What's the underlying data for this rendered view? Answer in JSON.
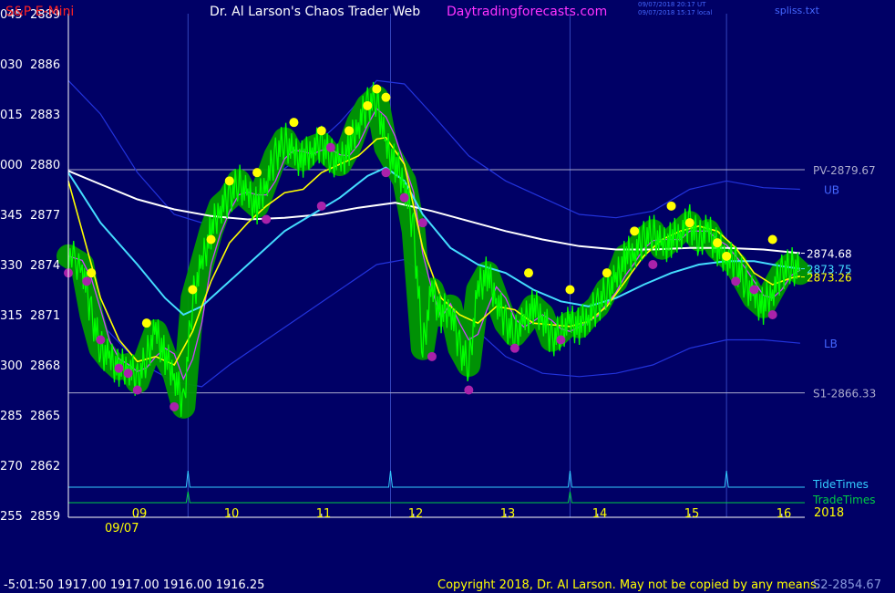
{
  "header": {
    "instrument": "S&P E-Mini",
    "title": "Dr. Al Larson's Chaos Trader Web",
    "site": "Daytradingforecasts.com",
    "stamp_utc": "09/07/2018 20:17 UT",
    "stamp_local": "09/07/2018 15:17 local",
    "file": "spliss.txt"
  },
  "footer": {
    "readout": "-5:01:50  1917.00 1917.00 1916.00 1916.25",
    "copyright": "Copyright 2018, Dr. Al Larson. May not be copied by any means.",
    "s2": "S2-2854.67"
  },
  "colors": {
    "background": "#000066",
    "price": "#00ff00",
    "halo": "#009900",
    "fast_avg": "#ffff00",
    "mid_avg": "#cc44ff",
    "slow_avg": "#44ddff",
    "long_avg": "#ffffff",
    "bands": "#2233dd",
    "levels": "#aaaacc",
    "tide": "#33ccff",
    "trade": "#00cc44",
    "high_dot": "#ffff00",
    "low_dot": "#aa22aa",
    "hour_line": "#3344bb"
  },
  "chart_data": {
    "type": "line",
    "title": "S&P E-Mini",
    "ylim": [
      2859,
      2889
    ],
    "y_ticks_left": [
      {
        "code": "045",
        "price": "2889",
        "value": 2889
      },
      {
        "code": "030",
        "price": "2886",
        "value": 2886
      },
      {
        "code": "015",
        "price": "2883",
        "value": 2883
      },
      {
        "code": "000",
        "price": "2880",
        "value": 2880
      },
      {
        "code": "345",
        "price": "2877",
        "value": 2877
      },
      {
        "code": "330",
        "price": "2874",
        "value": 2874
      },
      {
        "code": "315",
        "price": "2871",
        "value": 2871
      },
      {
        "code": "300",
        "price": "2868",
        "value": 2868
      },
      {
        "code": "285",
        "price": "2865",
        "value": 2865
      },
      {
        "code": "270",
        "price": "2862",
        "value": 2862
      },
      {
        "code": "255",
        "price": "2859",
        "value": 2859
      }
    ],
    "x_ticks": [
      {
        "label": "09",
        "hour": 9
      },
      {
        "label": "10",
        "hour": 10
      },
      {
        "label": "11",
        "hour": 11
      },
      {
        "label": "12",
        "hour": 12
      },
      {
        "label": "13",
        "hour": 13
      },
      {
        "label": "14",
        "hour": 14
      },
      {
        "label": "15",
        "hour": 15
      },
      {
        "label": "16",
        "hour": 16
      }
    ],
    "xlim_hours": [
      8.25,
      16.25
    ],
    "date_label": "09/07",
    "year_label": "2018",
    "levels": [
      {
        "label": "PV-2879.67",
        "value": 2879.67
      },
      {
        "label": "S1-2866.33",
        "value": 2866.33
      }
    ],
    "band_labels": [
      {
        "label": "UB",
        "value": 2878.5
      },
      {
        "label": "LB",
        "value": 2869.3
      }
    ],
    "right_values": [
      {
        "label": "2874.68",
        "value": 2874.68,
        "color": "#ffffff"
      },
      {
        "label": "2873.75",
        "value": 2873.75,
        "color": "#44ddff"
      },
      {
        "label": "2873.26",
        "value": 2873.26,
        "color": "#ffff00"
      }
    ],
    "marker_rows": [
      {
        "label": "TideTimes",
        "hours": [
          9.55,
          11.75,
          13.7,
          15.4
        ]
      },
      {
        "label": "TradeTimes",
        "hours": [
          9.55,
          13.7
        ]
      }
    ],
    "series": [
      {
        "name": "price",
        "hours": [
          8.25,
          8.4,
          8.5,
          8.6,
          8.7,
          8.8,
          8.9,
          9.0,
          9.1,
          9.2,
          9.3,
          9.4,
          9.5,
          9.6,
          9.7,
          9.8,
          9.9,
          10.0,
          10.1,
          10.2,
          10.3,
          10.4,
          10.5,
          10.6,
          10.7,
          10.8,
          10.9,
          11.0,
          11.1,
          11.2,
          11.3,
          11.4,
          11.5,
          11.6,
          11.7,
          11.8,
          11.9,
          12.0,
          12.1,
          12.2,
          12.3,
          12.4,
          12.5,
          12.6,
          12.7,
          12.8,
          12.9,
          13.0,
          13.1,
          13.2,
          13.3,
          13.4,
          13.5,
          13.6,
          13.7,
          13.8,
          13.9,
          14.0,
          14.1,
          14.2,
          14.3,
          14.4,
          14.5,
          14.6,
          14.7,
          14.8,
          14.9,
          15.0,
          15.1,
          15.2,
          15.3,
          15.4,
          15.5,
          15.6,
          15.7,
          15.8,
          15.9,
          16.0,
          16.1,
          16.2
        ],
        "values": [
          2874.5,
          2874.0,
          2871.0,
          2869.0,
          2868.3,
          2867.8,
          2868.0,
          2867.0,
          2868.5,
          2870.0,
          2868.5,
          2867.5,
          2865.5,
          2872.0,
          2874.0,
          2876.0,
          2877.5,
          2878.0,
          2879.0,
          2878.0,
          2877.5,
          2879.0,
          2880.5,
          2881.5,
          2880.5,
          2880.3,
          2881.0,
          2881.2,
          2880.5,
          2880.0,
          2881.0,
          2882.5,
          2883.5,
          2884.0,
          2881.0,
          2880.0,
          2879.0,
          2876.0,
          2869.0,
          2872.5,
          2871.0,
          2871.5,
          2869.0,
          2868.0,
          2872.5,
          2873.5,
          2872.0,
          2870.5,
          2869.8,
          2870.5,
          2871.5,
          2871.0,
          2869.5,
          2870.0,
          2870.5,
          2870.3,
          2871.0,
          2871.5,
          2872.5,
          2873.0,
          2874.5,
          2874.8,
          2875.5,
          2876.0,
          2875.0,
          2875.5,
          2876.0,
          2876.5,
          2875.5,
          2876.0,
          2875.0,
          2874.5,
          2874.0,
          2873.0,
          2872.0,
          2871.5,
          2872.5,
          2873.5,
          2874.0,
          2873.5
        ]
      },
      {
        "name": "fast_avg",
        "hours": [
          8.25,
          8.4,
          8.6,
          8.8,
          9.0,
          9.2,
          9.4,
          9.6,
          9.8,
          10.0,
          10.2,
          10.4,
          10.6,
          10.8,
          11.0,
          11.2,
          11.4,
          11.6,
          11.7,
          11.9,
          12.1,
          12.3,
          12.5,
          12.7,
          12.9,
          13.1,
          13.3,
          13.5,
          13.7,
          13.9,
          14.1,
          14.3,
          14.5,
          14.7,
          14.9,
          15.1,
          15.3,
          15.5,
          15.7,
          15.9,
          16.1,
          16.2
        ],
        "values": [
          2879.0,
          2876.0,
          2872.0,
          2869.5,
          2868.2,
          2868.5,
          2868.0,
          2870.0,
          2873.0,
          2875.3,
          2876.5,
          2877.5,
          2878.3,
          2878.5,
          2879.5,
          2880.0,
          2880.5,
          2881.5,
          2881.6,
          2880.0,
          2875.0,
          2872.0,
          2871.0,
          2870.5,
          2871.5,
          2871.3,
          2870.5,
          2870.4,
          2870.3,
          2870.6,
          2871.5,
          2873.0,
          2874.5,
          2875.5,
          2876.0,
          2876.3,
          2876.0,
          2875.0,
          2873.5,
          2872.8,
          2873.2,
          2873.3
        ]
      },
      {
        "name": "slow_avg",
        "hours": [
          8.25,
          8.6,
          9.0,
          9.3,
          9.5,
          9.7,
          10.0,
          10.3,
          10.6,
          10.9,
          11.2,
          11.5,
          11.7,
          11.9,
          12.1,
          12.4,
          12.7,
          13.0,
          13.3,
          13.6,
          13.9,
          14.2,
          14.5,
          14.8,
          15.1,
          15.4,
          15.7,
          16.0,
          16.2
        ],
        "values": [
          2879.5,
          2876.5,
          2874.0,
          2872.0,
          2871.0,
          2871.5,
          2873.0,
          2874.5,
          2876.0,
          2877.0,
          2878.0,
          2879.3,
          2879.8,
          2879.0,
          2877.0,
          2875.0,
          2874.0,
          2873.5,
          2872.5,
          2871.8,
          2871.5,
          2872.0,
          2872.8,
          2873.5,
          2874.0,
          2874.2,
          2874.2,
          2873.9,
          2873.75
        ]
      },
      {
        "name": "long_avg",
        "hours": [
          8.25,
          8.6,
          9.0,
          9.4,
          9.8,
          10.2,
          10.6,
          11.0,
          11.4,
          11.8,
          12.2,
          12.6,
          13.0,
          13.4,
          13.8,
          14.2,
          14.6,
          15.0,
          15.4,
          15.8,
          16.2
        ],
        "values": [
          2879.6,
          2878.8,
          2877.9,
          2877.3,
          2876.9,
          2876.7,
          2876.8,
          2877.0,
          2877.4,
          2877.7,
          2877.2,
          2876.6,
          2876.0,
          2875.5,
          2875.1,
          2874.9,
          2874.9,
          2875.0,
          2875.0,
          2874.9,
          2874.68
        ]
      },
      {
        "name": "upper_band",
        "hours": [
          8.25,
          8.6,
          9.0,
          9.4,
          9.7,
          10.0,
          10.4,
          10.8,
          11.2,
          11.6,
          11.9,
          12.2,
          12.6,
          13.0,
          13.4,
          13.8,
          14.2,
          14.6,
          15.0,
          15.4,
          15.8,
          16.2
        ],
        "values": [
          2885.0,
          2883.0,
          2879.5,
          2877.0,
          2876.5,
          2877.5,
          2879.0,
          2880.5,
          2882.5,
          2885.0,
          2884.8,
          2883.0,
          2880.5,
          2879.0,
          2878.0,
          2877.0,
          2876.8,
          2877.2,
          2878.5,
          2879.0,
          2878.6,
          2878.5
        ]
      },
      {
        "name": "lower_band",
        "hours": [
          8.25,
          8.6,
          9.0,
          9.4,
          9.7,
          10.0,
          10.4,
          10.8,
          11.2,
          11.6,
          11.9,
          12.2,
          12.6,
          13.0,
          13.4,
          13.8,
          14.2,
          14.6,
          15.0,
          15.4,
          15.8,
          16.2
        ],
        "values": [
          2874.0,
          2870.5,
          2868.2,
          2867.0,
          2866.7,
          2868.0,
          2869.5,
          2871.0,
          2872.5,
          2874.0,
          2874.3,
          2873.0,
          2870.5,
          2868.5,
          2867.5,
          2867.3,
          2867.5,
          2868.0,
          2869.0,
          2869.5,
          2869.5,
          2869.3
        ]
      }
    ],
    "highs": [
      [
        8.5,
        2873.5
      ],
      [
        9.1,
        2870.5
      ],
      [
        9.6,
        2872.5
      ],
      [
        9.8,
        2875.5
      ],
      [
        10.0,
        2879.0
      ],
      [
        10.3,
        2879.5
      ],
      [
        10.7,
        2882.5
      ],
      [
        11.0,
        2882.0
      ],
      [
        11.3,
        2882.0
      ],
      [
        11.5,
        2883.5
      ],
      [
        11.6,
        2884.5
      ],
      [
        11.7,
        2884.0
      ],
      [
        13.25,
        2873.5
      ],
      [
        13.7,
        2872.5
      ],
      [
        14.1,
        2873.5
      ],
      [
        14.4,
        2876.0
      ],
      [
        14.8,
        2877.5
      ],
      [
        15.0,
        2876.5
      ],
      [
        15.3,
        2875.3
      ],
      [
        15.4,
        2874.5
      ],
      [
        15.9,
        2875.5
      ]
    ],
    "lows": [
      [
        8.25,
        2873.5
      ],
      [
        8.45,
        2873.0
      ],
      [
        8.6,
        2869.5
      ],
      [
        8.8,
        2867.8
      ],
      [
        8.9,
        2867.5
      ],
      [
        9.0,
        2866.5
      ],
      [
        9.4,
        2865.5
      ],
      [
        10.4,
        2876.7
      ],
      [
        11.0,
        2877.5
      ],
      [
        11.1,
        2881.0
      ],
      [
        11.7,
        2879.5
      ],
      [
        11.9,
        2878.0
      ],
      [
        12.1,
        2876.5
      ],
      [
        12.2,
        2868.5
      ],
      [
        12.6,
        2866.5
      ],
      [
        13.1,
        2869.0
      ],
      [
        13.6,
        2869.5
      ],
      [
        14.6,
        2874.0
      ],
      [
        15.5,
        2873.0
      ],
      [
        15.7,
        2872.5
      ],
      [
        15.9,
        2871.0
      ]
    ]
  }
}
